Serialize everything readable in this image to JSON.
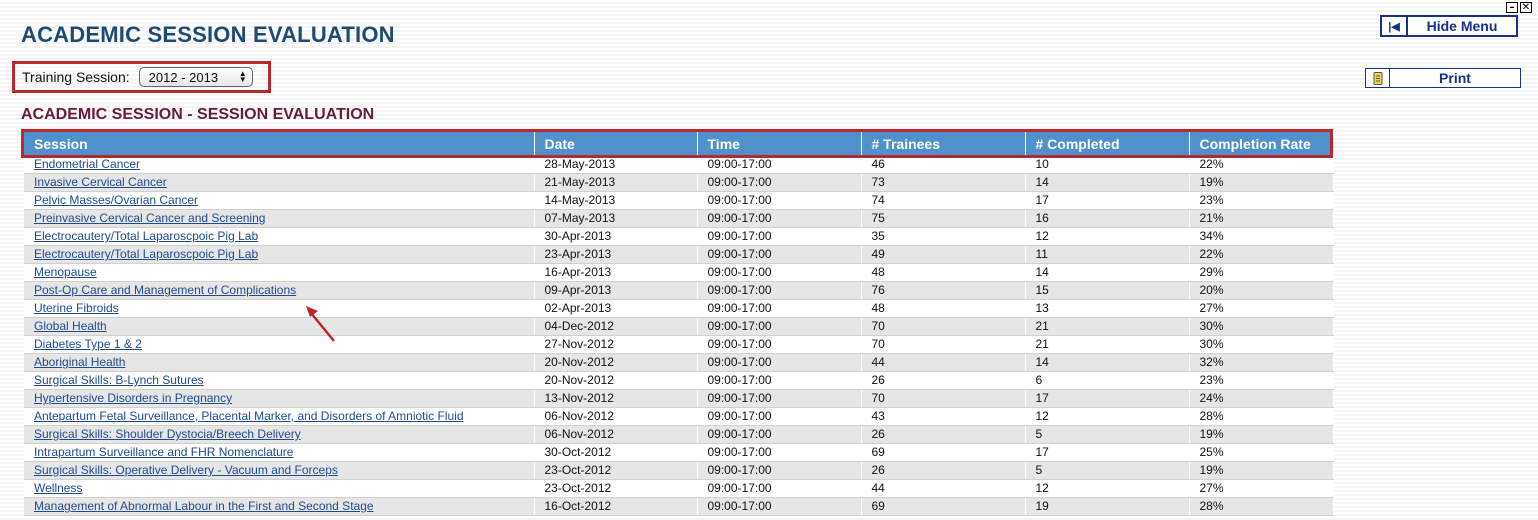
{
  "window": {
    "minimize_glyph": "–",
    "close_glyph": "✕"
  },
  "page": {
    "title": "ACADEMIC SESSION EVALUATION"
  },
  "toolbar": {
    "hide_menu_label": "Hide Menu",
    "hide_menu_icon": "|◀",
    "print_label": "Print",
    "print_icon": "printer-icon"
  },
  "session_filter": {
    "label": "Training Session:",
    "selected": "2012 - 2013"
  },
  "section": {
    "title": "ACADEMIC SESSION - SESSION EVALUATION"
  },
  "table": {
    "columns": [
      "Session",
      "Date",
      "Time",
      "# Trainees",
      "# Completed",
      "Completion Rate"
    ],
    "rows": [
      [
        "Endometrial Cancer",
        "28-May-2013",
        "09:00-17:00",
        "46",
        "10",
        "22%"
      ],
      [
        "Invasive Cervical Cancer",
        "21-May-2013",
        "09:00-17:00",
        "73",
        "14",
        "19%"
      ],
      [
        "Pelvic Masses/Ovarian Cancer",
        "14-May-2013",
        "09:00-17:00",
        "74",
        "17",
        "23%"
      ],
      [
        "Preinvasive Cervical Cancer and Screening",
        "07-May-2013",
        "09:00-17:00",
        "75",
        "16",
        "21%"
      ],
      [
        "Electrocautery/Total Laparoscpoic Pig Lab",
        "30-Apr-2013",
        "09:00-17:00",
        "35",
        "12",
        "34%"
      ],
      [
        "Electrocautery/Total Laparoscpoic Pig Lab",
        "23-Apr-2013",
        "09:00-17:00",
        "49",
        "11",
        "22%"
      ],
      [
        "Menopause",
        "16-Apr-2013",
        "09:00-17:00",
        "48",
        "14",
        "29%"
      ],
      [
        "Post-Op Care and Management of Complications",
        "09-Apr-2013",
        "09:00-17:00",
        "76",
        "15",
        "20%"
      ],
      [
        "Uterine Fibroids",
        "02-Apr-2013",
        "09:00-17:00",
        "48",
        "13",
        "27%"
      ],
      [
        "Global Health",
        "04-Dec-2012",
        "09:00-17:00",
        "70",
        "21",
        "30%"
      ],
      [
        "Diabetes Type 1 & 2",
        "27-Nov-2012",
        "09:00-17:00",
        "70",
        "21",
        "30%"
      ],
      [
        "Aboriginal Health",
        "20-Nov-2012",
        "09:00-17:00",
        "44",
        "14",
        "32%"
      ],
      [
        "Surgical Skills: B-Lynch Sutures",
        "20-Nov-2012",
        "09:00-17:00",
        "26",
        "6",
        "23%"
      ],
      [
        "Hypertensive Disorders in Pregnancy",
        "13-Nov-2012",
        "09:00-17:00",
        "70",
        "17",
        "24%"
      ],
      [
        "Antepartum Fetal Surveillance, Placental Marker, and Disorders of Amniotic Fluid",
        "06-Nov-2012",
        "09:00-17:00",
        "43",
        "12",
        "28%"
      ],
      [
        "Surgical Skills: Shoulder Dystocia/Breech Delivery",
        "06-Nov-2012",
        "09:00-17:00",
        "26",
        "5",
        "19%"
      ],
      [
        "Intrapartum Surveillance and FHR Nomenclature",
        "30-Oct-2012",
        "09:00-17:00",
        "69",
        "17",
        "25%"
      ],
      [
        "Surgical Skills: Operative Delivery - Vacuum and Forceps",
        "23-Oct-2012",
        "09:00-17:00",
        "26",
        "5",
        "19%"
      ],
      [
        "Wellness",
        "23-Oct-2012",
        "09:00-17:00",
        "44",
        "12",
        "27%"
      ],
      [
        "Management of Abnormal Labour in the First and Second Stage",
        "16-Oct-2012",
        "09:00-17:00",
        "69",
        "19",
        "28%"
      ]
    ]
  },
  "colors": {
    "header_blue": "#4f91cb",
    "title_blue": "#1f4a74",
    "section_maroon": "#6a1b3d",
    "highlight_red": "#b8282c",
    "link_blue": "#1f4a8e"
  }
}
